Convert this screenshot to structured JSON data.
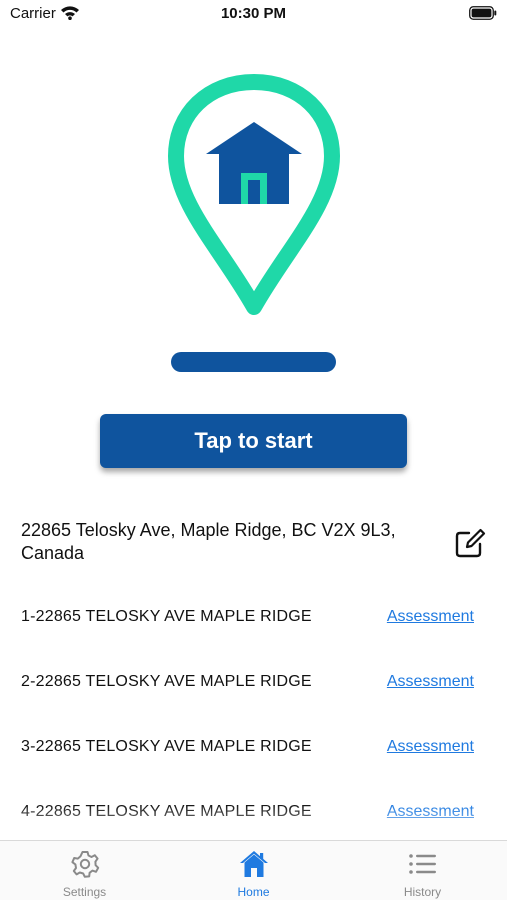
{
  "status_bar": {
    "carrier": "Carrier",
    "time": "10:30 PM"
  },
  "hero": {
    "icon": "home-location-pin-icon",
    "colors": {
      "pin": "#1fd8a8",
      "house": "#0f549e"
    }
  },
  "start_button": {
    "label": "Tap to start"
  },
  "address": {
    "text": "22865 Telosky Ave, Maple Ridge, BC V2X 9L3, Canada",
    "edit_icon": "edit-icon"
  },
  "results": [
    {
      "title": "1-22865 TELOSKY AVE MAPLE RIDGE",
      "link": "Assessment"
    },
    {
      "title": "2-22865 TELOSKY AVE MAPLE RIDGE",
      "link": "Assessment"
    },
    {
      "title": "3-22865 TELOSKY AVE MAPLE RIDGE",
      "link": "Assessment"
    },
    {
      "title": "4-22865 TELOSKY AVE MAPLE RIDGE",
      "link": "Assessment"
    }
  ],
  "tab_bar": {
    "tabs": [
      {
        "label": "Settings",
        "icon": "gear-icon",
        "active": false
      },
      {
        "label": "Home",
        "icon": "home-icon",
        "active": true
      },
      {
        "label": "History",
        "icon": "list-icon",
        "active": false
      }
    ],
    "colors": {
      "active": "#1f7ae0",
      "inactive": "#8a8a8a"
    }
  }
}
